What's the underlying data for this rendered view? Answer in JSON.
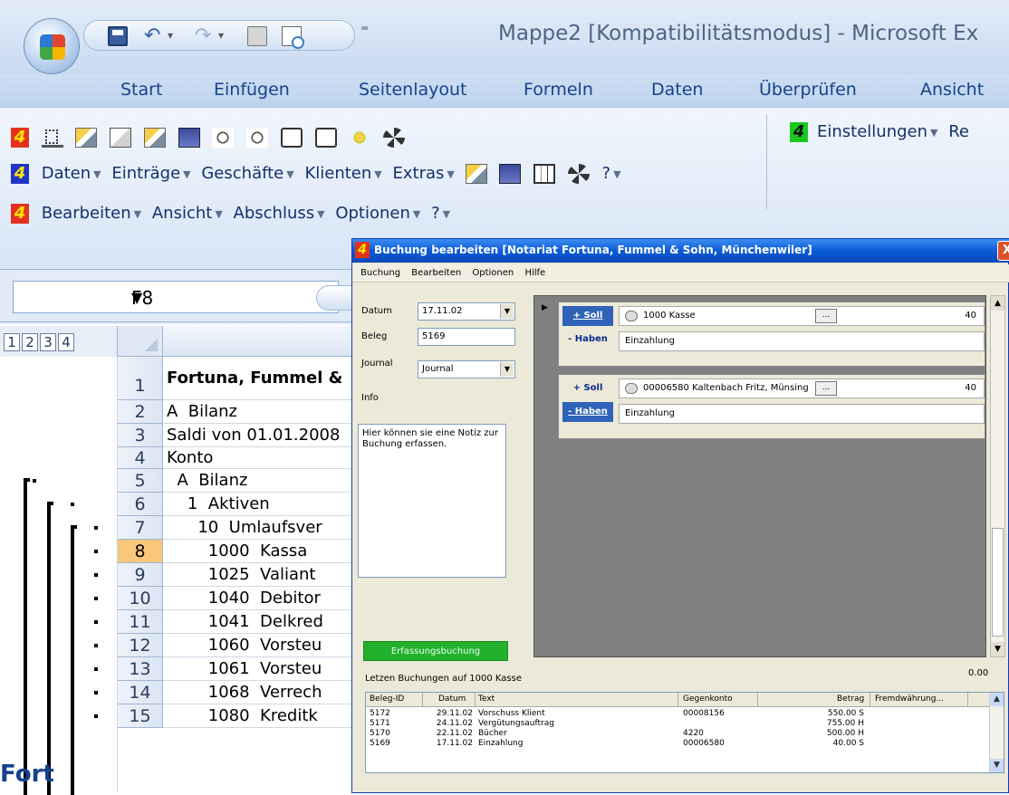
{
  "excel": {
    "window_title": "Mappe2  [Kompatibilitätsmodus] - Microsoft Ex",
    "tabs": [
      "Start",
      "Einfügen",
      "Seitenlayout",
      "Formeln",
      "Daten",
      "Überprüfen",
      "Ansicht"
    ],
    "ribbon": {
      "menu_row1": [
        "Daten",
        "Einträge",
        "Geschäfte",
        "Klienten",
        "Extras"
      ],
      "menu_row1_help": "?",
      "menu_row2": [
        "Bearbeiten",
        "Ansicht",
        "Abschluss",
        "Optionen",
        "?"
      ],
      "settings_label": "Einstellungen",
      "settings_truncated": "Re",
      "addin_badge": "4"
    },
    "namebox": "F8",
    "outline_levels": [
      "1",
      "2",
      "3",
      "4"
    ],
    "rows": [
      {
        "num": "1",
        "text": "Fortuna, Fummel &",
        "bold": true
      },
      {
        "num": "2",
        "text": "A  Bilanz"
      },
      {
        "num": "3",
        "text": "Saldi von 01.01.2008"
      },
      {
        "num": "4",
        "text": "Konto"
      },
      {
        "num": "5",
        "text": "  A  Bilanz"
      },
      {
        "num": "6",
        "text": "    1  Aktiven"
      },
      {
        "num": "7",
        "text": "      10  Umlaufsver"
      },
      {
        "num": "8",
        "text": "        1000  Kassa",
        "active": true
      },
      {
        "num": "9",
        "text": "        1025  Valiant"
      },
      {
        "num": "10",
        "text": "        1040  Debitor"
      },
      {
        "num": "11",
        "text": "        1041  Delkred"
      },
      {
        "num": "12",
        "text": "        1060  Vorsteu"
      },
      {
        "num": "13",
        "text": "        1061  Vorsteu"
      },
      {
        "num": "14",
        "text": "        1068  Verrech"
      },
      {
        "num": "15",
        "text": "        1080  Kreditk"
      }
    ],
    "bottom_text": "Fort"
  },
  "dialog": {
    "title": "Buchung bearbeiten [Notariat Fortuna, Fummel & Sohn, Münchenwiler]",
    "close": "X",
    "menu": [
      "Buchung",
      "Bearbeiten",
      "Optionen",
      "Hilfe"
    ],
    "fields": {
      "datum_label": "Datum",
      "datum_value": "17.11.02",
      "beleg_label": "Beleg",
      "beleg_value": "5169",
      "journal_label": "Journal",
      "journal_value": "Journal",
      "info_label": "Info",
      "note": "Hier können sie eine Notiz zur Buchung erfassen."
    },
    "status_button": "Erfassungsbuchung",
    "entries": [
      {
        "soll": "+ Soll",
        "haben": "- Haben",
        "active": "soll",
        "account": "1000 Kasse",
        "amount": "40",
        "text": "Einzahlung"
      },
      {
        "soll": "+ Soll",
        "haben": "- Haben",
        "active": "haben",
        "account": "00006580 Kaltenbach Fritz, Münsing",
        "amount": "40",
        "text": "Einzahlung"
      }
    ],
    "balance": "0.00",
    "last_label": "Letzen Buchungen auf  1000 Kasse",
    "list_headers": [
      "Beleg-ID",
      "Datum",
      "Text",
      "Gegenkonto",
      "Betrag",
      "Fremdwährung..."
    ],
    "list_rows": [
      [
        "5172",
        "29.11.02",
        "Vorschuss Klient",
        "00008156",
        "550.00 S",
        ""
      ],
      [
        "5171",
        "24.11.02",
        "Vergütungsauftrag",
        "",
        "755.00 H",
        ""
      ],
      [
        "5170",
        "22.11.02",
        "Bücher",
        "4220",
        "500.00 H",
        ""
      ],
      [
        "5169",
        "17.11.02",
        "Einzahlung",
        "00006580",
        "40.00 S",
        ""
      ]
    ]
  }
}
